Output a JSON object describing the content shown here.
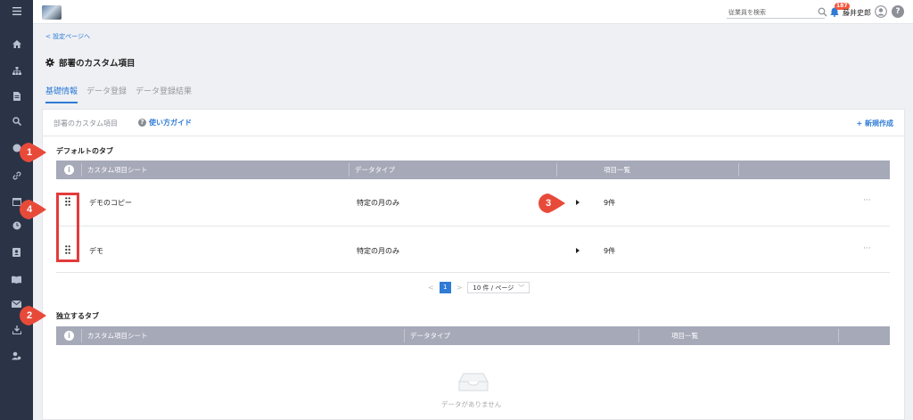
{
  "colors": {
    "accent": "#2f7bd6",
    "sidebar": "#2b3447",
    "table_header": "#a6a9b8",
    "badge": "#f5573b",
    "callout": "#e84a3a",
    "highlight": "#e33b3b"
  },
  "sidebar": {
    "icons": [
      "menu-icon",
      "home-icon",
      "org-chart-icon",
      "document-icon",
      "search-icon",
      "pie-chart-icon",
      "link-icon",
      "calendar-icon",
      "clock-icon",
      "contact-card-icon",
      "book-icon",
      "mail-icon",
      "download-icon",
      "user-settings-icon"
    ]
  },
  "topbar": {
    "search_placeholder": "従業員を検索",
    "notification_count": "187",
    "user_name": "藤井史郎",
    "help_label": "?"
  },
  "nav": {
    "back_link": "< 設定ページへ"
  },
  "page": {
    "title": "部署のカスタム項目"
  },
  "tabs": [
    {
      "label": "基礎情報",
      "active": true
    },
    {
      "label": "データ登録",
      "active": false
    },
    {
      "label": "データ登録結果",
      "active": false
    }
  ],
  "panel": {
    "title": "部署のカスタム項目",
    "guide_label": "使い方ガイド",
    "guide_icon_text": "?",
    "new_button": "+ 新規作成"
  },
  "default_section": {
    "label": "デフォルトのタブ",
    "info_icon_text": "i",
    "columns": [
      "カスタム項目シート",
      "データタイプ",
      "項目一覧"
    ],
    "rows": [
      {
        "name": "デモのコピー",
        "type": "特定の月のみ",
        "count": "9件",
        "menu": "···"
      },
      {
        "name": "デモ",
        "type": "特定の月のみ",
        "count": "9件",
        "menu": "···"
      }
    ],
    "pagination": {
      "prev": "<",
      "current": "1",
      "next": ">",
      "page_size": "10 件 / ページ",
      "dropdown_arrow": "﹀"
    }
  },
  "independent_section": {
    "label": "独立するタブ",
    "info_icon_text": "i",
    "columns": [
      "カスタム項目シート",
      "データタイプ",
      "項目一覧"
    ],
    "empty_text": "データがありません"
  },
  "callouts": [
    "1",
    "2",
    "3",
    "4"
  ]
}
